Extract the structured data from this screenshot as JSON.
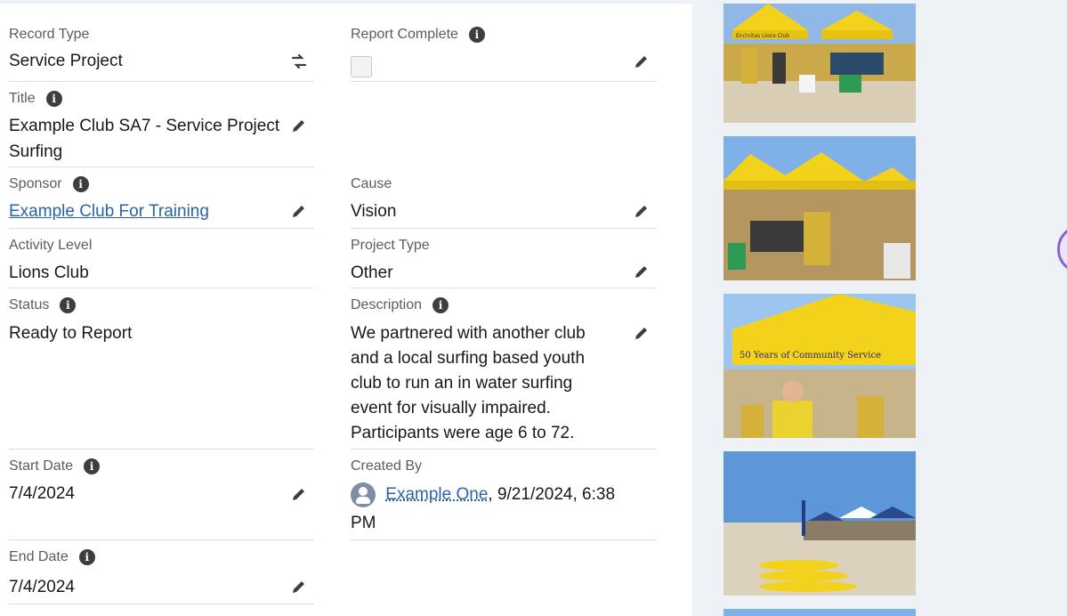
{
  "fields": {
    "record_type": {
      "label": "Record Type",
      "value": "Service Project"
    },
    "report_complete": {
      "label": "Report Complete",
      "checked": false
    },
    "title": {
      "label": "Title",
      "value_line1": "Example Club SA7 - Service Project",
      "value_line2": "Surfing"
    },
    "sponsor": {
      "label": "Sponsor",
      "value": "Example Club For Training"
    },
    "cause": {
      "label": "Cause",
      "value": "Vision"
    },
    "activity_level": {
      "label": "Activity Level",
      "value": "Lions Club"
    },
    "project_type": {
      "label": "Project Type",
      "value": "Other"
    },
    "status": {
      "label": "Status",
      "value": "Ready to Report"
    },
    "description": {
      "label": "Description",
      "lines": [
        "We partnered with another club",
        "and a local surfing based youth",
        "club to run an in water surfing",
        "event for visually impaired.",
        "Participants were age 6 to 72."
      ]
    },
    "start_date": {
      "label": "Start Date",
      "value": "7/4/2024"
    },
    "created_by": {
      "label": "Created By",
      "user": "Example One",
      "datetime_part1": ", 9/21/2024, 6:38",
      "datetime_part2": "PM"
    },
    "end_date": {
      "label": "End Date",
      "value": "7/4/2024"
    }
  },
  "icons": {
    "info": "info-icon",
    "edit": "pencil-icon",
    "change_record_type": "swap-icon",
    "user": "user-avatar-icon"
  },
  "photos": {
    "photo1_banner": "Encinitas Lions Club",
    "photo3_banner": "50 Years of Community Service"
  },
  "colors": {
    "link": "#2a63a8",
    "border": "#d8dde6",
    "label": "#5c5c5c",
    "canopy": "#f2d21a"
  }
}
